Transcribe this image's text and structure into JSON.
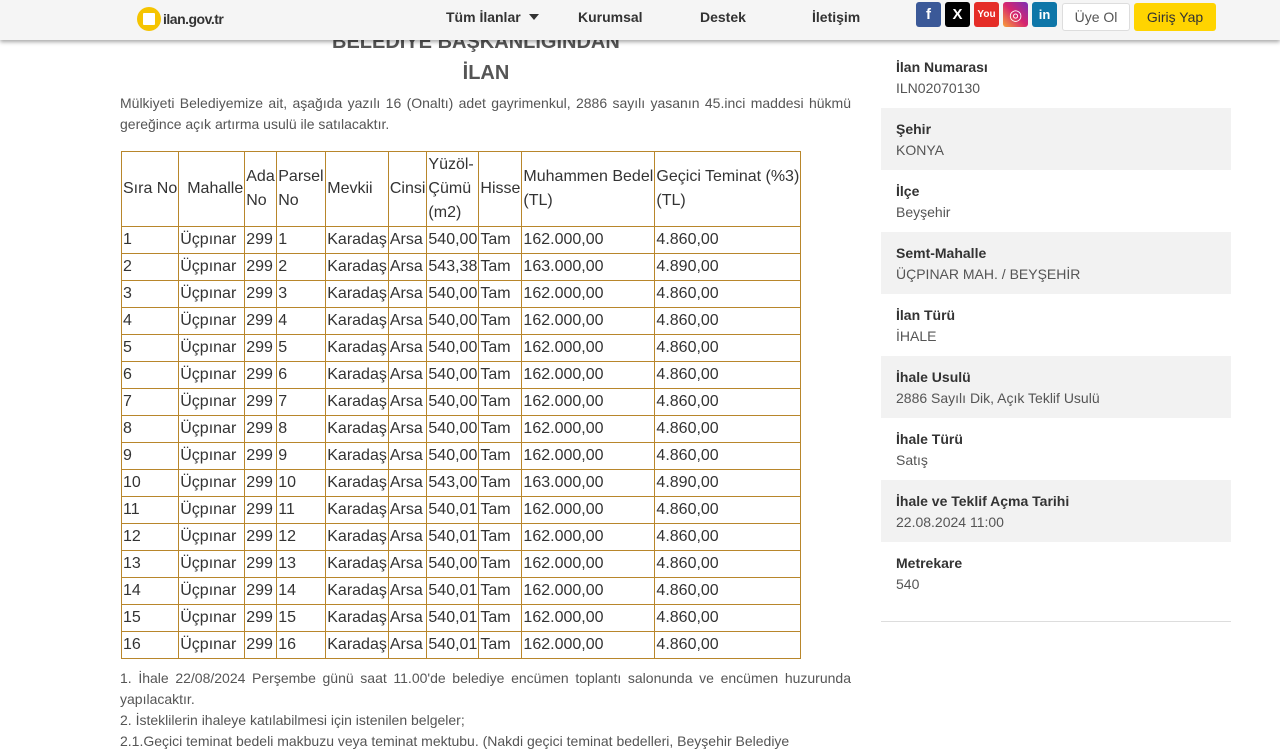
{
  "header": {
    "logo_text": "ilan.gov.tr",
    "nav": [
      {
        "label": "Tüm İlanlar"
      },
      {
        "label": "Kurumsal"
      },
      {
        "label": "Destek"
      },
      {
        "label": "İletişim"
      }
    ],
    "social": [
      {
        "name": "facebook",
        "glyph": "f",
        "color": "#3b5998"
      },
      {
        "name": "x",
        "glyph": "X",
        "color": "#000000"
      },
      {
        "name": "youtube",
        "glyph": "You",
        "color": "#e52d27"
      },
      {
        "name": "instagram",
        "glyph": "◎",
        "color": "#c13584"
      },
      {
        "name": "linkedin",
        "glyph": "in",
        "color": "#0e76a8"
      }
    ],
    "register_label": "Üye Ol",
    "login_label": "Giriş Yap"
  },
  "main": {
    "heading_partial": "BELEDİYE BAŞKANLIĞINDAN",
    "heading": "İLAN",
    "intro": "Mülkiyeti Belediyemize ait, aşağıda yazılı 16 (Onaltı)  adet gayrimenkul, 2886 sayılı yasanın 45.inci maddesi hükmü gereğince açık artırma usulü ile satılacaktır.",
    "table": {
      "headers": [
        "Sıra No",
        "Mahalle",
        "Ada No",
        "Parsel No",
        "Mevkii",
        "Cinsi",
        "Yüzöl-Çümü (m2)",
        "Hisse",
        "Muhammen Bedel (TL)",
        "Geçici Teminat (%3) (TL)"
      ],
      "rows": [
        [
          "1",
          "Üçpınar",
          "299",
          "1",
          "Karadaş",
          "Arsa",
          "540,00",
          "Tam",
          "162.000,00",
          "4.860,00"
        ],
        [
          "2",
          "Üçpınar",
          "299",
          "2",
          "Karadaş",
          "Arsa",
          "543,38",
          "Tam",
          "163.000,00",
          "4.890,00"
        ],
        [
          "3",
          "Üçpınar",
          "299",
          "3",
          "Karadaş",
          "Arsa",
          "540,00",
          "Tam",
          "162.000,00",
          "4.860,00"
        ],
        [
          "4",
          "Üçpınar",
          "299",
          "4",
          "Karadaş",
          "Arsa",
          "540,00",
          "Tam",
          "162.000,00",
          "4.860,00"
        ],
        [
          "5",
          "Üçpınar",
          "299",
          "5",
          "Karadaş",
          "Arsa",
          "540,00",
          "Tam",
          "162.000,00",
          "4.860,00"
        ],
        [
          "6",
          "Üçpınar",
          "299",
          "6",
          "Karadaş",
          "Arsa",
          "540,00",
          "Tam",
          "162.000,00",
          "4.860,00"
        ],
        [
          "7",
          "Üçpınar",
          "299",
          "7",
          "Karadaş",
          "Arsa",
          "540,00",
          "Tam",
          "162.000,00",
          "4.860,00"
        ],
        [
          "8",
          "Üçpınar",
          "299",
          "8",
          "Karadaş",
          "Arsa",
          "540,00",
          "Tam",
          "162.000,00",
          "4.860,00"
        ],
        [
          "9",
          "Üçpınar",
          "299",
          "9",
          "Karadaş",
          "Arsa",
          "540,00",
          "Tam",
          "162.000,00",
          "4.860,00"
        ],
        [
          "10",
          "Üçpınar",
          "299",
          "10",
          "Karadaş",
          "Arsa",
          "543,00",
          "Tam",
          "163.000,00",
          "4.890,00"
        ],
        [
          "11",
          "Üçpınar",
          "299",
          "11",
          "Karadaş",
          "Arsa",
          "540,01",
          "Tam",
          "162.000,00",
          "4.860,00"
        ],
        [
          "12",
          "Üçpınar",
          "299",
          "12",
          "Karadaş",
          "Arsa",
          "540,01",
          "Tam",
          "162.000,00",
          "4.860,00"
        ],
        [
          "13",
          "Üçpınar",
          "299",
          "13",
          "Karadaş",
          "Arsa",
          "540,00",
          "Tam",
          "162.000,00",
          "4.860,00"
        ],
        [
          "14",
          "Üçpınar",
          "299",
          "14",
          "Karadaş",
          "Arsa",
          "540,01",
          "Tam",
          "162.000,00",
          "4.860,00"
        ],
        [
          "15",
          "Üçpınar",
          "299",
          "15",
          "Karadaş",
          "Arsa",
          "540,01",
          "Tam",
          "162.000,00",
          "4.860,00"
        ],
        [
          "16",
          "Üçpınar",
          "299",
          "16",
          "Karadaş",
          "Arsa",
          "540,01",
          "Tam",
          "162.000,00",
          "4.860,00"
        ]
      ]
    },
    "notes": [
      "1. İhale 22/08/2024 Perşembe günü saat 11.00'de belediye encümen toplantı salonunda ve encümen huzurunda yapılacaktır.",
      "2. İsteklilerin ihaleye katılabilmesi için istenilen belgeler;",
      "2.1.Geçici teminat bedeli makbuzu veya teminat mektubu. (Nakdi geçici teminat bedelleri, Beyşehir Belediye"
    ]
  },
  "sidebar": {
    "items": [
      {
        "label": "İlan Numarası",
        "value": "ILN02070130"
      },
      {
        "label": "Şehir",
        "value": "KONYA"
      },
      {
        "label": "İlçe",
        "value": "Beyşehir"
      },
      {
        "label": "Semt-Mahalle",
        "value": "ÜÇPINAR MAH. / BEYŞEHİR"
      },
      {
        "label": "İlan Türü",
        "value": "İHALE"
      },
      {
        "label": "İhale Usulü",
        "value": "2886 Sayılı Dik, Açık Teklif Usulü"
      },
      {
        "label": "İhale Türü",
        "value": "Satış"
      },
      {
        "label": "İhale ve Teklif Açma Tarihi",
        "value": "22.08.2024 11:00"
      },
      {
        "label": "Metrekare",
        "value": "540"
      }
    ]
  }
}
